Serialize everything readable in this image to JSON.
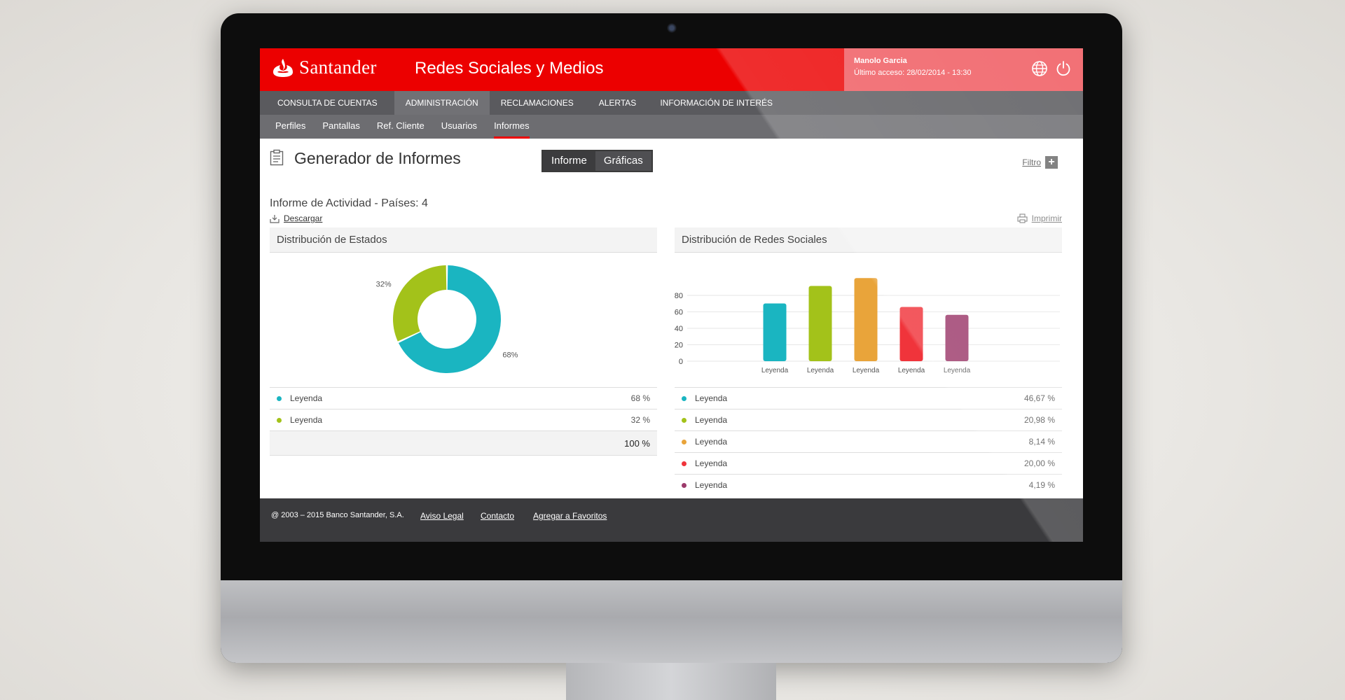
{
  "header": {
    "brand": "Santander",
    "app_title": "Redes Sociales y Medios",
    "user_name": "Manolo Garcia",
    "last_access": "Último acceso: 28/02/2014 - 13:30",
    "icons": [
      "globe-icon",
      "power-icon"
    ],
    "colors": {
      "brand_red": "#ec0000",
      "user_panel": "#f05a60"
    }
  },
  "nav_primary": [
    {
      "label": "CONSULTA DE CUENTAS",
      "active": false
    },
    {
      "label": "ADMINISTRACIÓN",
      "active": true
    },
    {
      "label": "RECLAMACIONES",
      "active": false
    },
    {
      "label": "ALERTAS",
      "active": false
    },
    {
      "label": "INFORMACIÓN DE INTERÉS",
      "active": false
    }
  ],
  "nav_secondary": [
    {
      "label": "Perfiles",
      "active": false
    },
    {
      "label": "Pantallas",
      "active": false
    },
    {
      "label": "Ref. Cliente",
      "active": false
    },
    {
      "label": "Usuarios",
      "active": false
    },
    {
      "label": "Informes",
      "active": true
    }
  ],
  "page": {
    "title": "Generador de Informes",
    "toggle": {
      "informe": "Informe",
      "graficas": "Gráficas",
      "selected": "Informe"
    },
    "filter_label": "Filtro",
    "report_title": "Informe de Actividad - Países: 4",
    "download_label": "Descargar",
    "print_label": "Imprimir"
  },
  "panel_estados": {
    "title": "Distribución de Estados",
    "legend": [
      {
        "name": "Leyenda",
        "value": "68 %",
        "color": "#1ab5c1"
      },
      {
        "name": "Leyenda",
        "value": "32 %",
        "color": "#a3c21a"
      }
    ],
    "total": "100 %"
  },
  "panel_redes": {
    "title": "Distribución de Redes Sociales",
    "legend": [
      {
        "name": "Leyenda",
        "value": "46,67 %",
        "color": "#1ab5c1"
      },
      {
        "name": "Leyenda",
        "value": "20,98 %",
        "color": "#a3c21a"
      },
      {
        "name": "Leyenda",
        "value": "8,14 %",
        "color": "#e9a43a"
      },
      {
        "name": "Leyenda",
        "value": "20,00 %",
        "color": "#f0343b"
      },
      {
        "name": "Leyenda",
        "value": "4,19 %",
        "color": "#9c3a6b"
      }
    ]
  },
  "chart_data": [
    {
      "type": "pie",
      "title": "Distribución de Estados",
      "donut": true,
      "categories": [
        "68%",
        "32%"
      ],
      "values": [
        68,
        32
      ],
      "colors": [
        "#1ab5c1",
        "#a3c21a"
      ],
      "labels": [
        "68%",
        "32%"
      ]
    },
    {
      "type": "bar",
      "title": "Distribución de Redes Sociales",
      "categories": [
        "Leyenda",
        "Leyenda",
        "Leyenda",
        "Leyenda",
        "Leyenda"
      ],
      "values": [
        66,
        86,
        95,
        62,
        53
      ],
      "colors": [
        "#1ab5c1",
        "#a3c21a",
        "#e9a43a",
        "#f0343b",
        "#9c3a6b"
      ],
      "y_ticks": [
        "0",
        "20",
        "40",
        "60",
        "80"
      ],
      "ylim": [
        0,
        100
      ],
      "grid": true
    }
  ],
  "footer": {
    "copyright": "@ 2003 – 2015 Banco Santander, S.A.",
    "links": [
      "Aviso Legal",
      "Contacto",
      "Agregar a Favoritos"
    ]
  }
}
